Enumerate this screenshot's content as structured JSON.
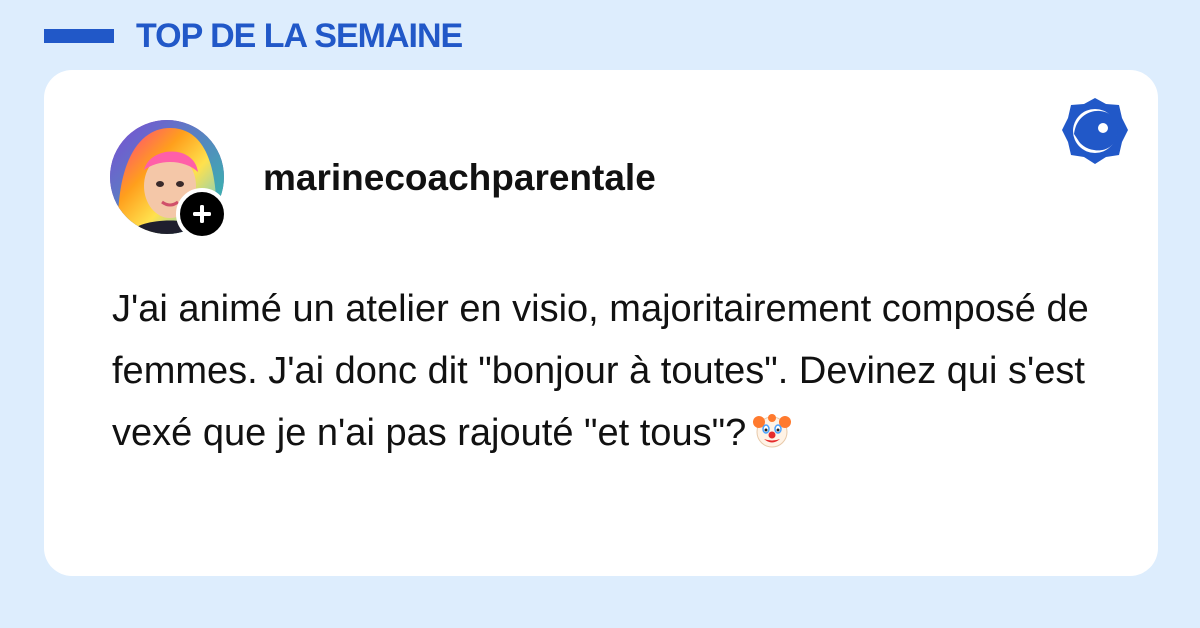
{
  "header": {
    "title": "TOP DE LA SEMAINE"
  },
  "post": {
    "username": "marinecoachparentale",
    "text": "J'ai animé un atelier en visio, majoritairement composé de femmes. J'ai donc dit \"bonjour à toutes\". Devinez qui s'est vexé que je n'ai pas rajouté \"et tous\"?",
    "emoji": "clown-face-icon",
    "avatar": "profile-avatar",
    "follow_icon": "plus-icon"
  },
  "brand": {
    "icon": "brand-logo-icon"
  },
  "colors": {
    "accent": "#2158c8",
    "background": "#ddedfd",
    "card": "#ffffff",
    "text": "#111111"
  }
}
